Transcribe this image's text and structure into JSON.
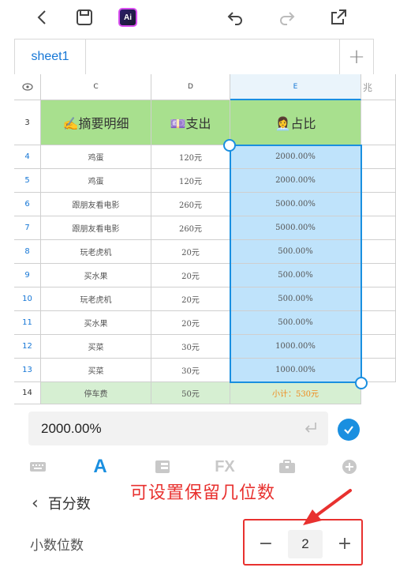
{
  "toolbar": {
    "back_icon": "chevron-left-icon",
    "save_icon": "save-icon",
    "ai_label": "Ai",
    "undo_icon": "undo-icon",
    "redo_icon": "redo-icon",
    "share_icon": "share-icon"
  },
  "tabs": {
    "sheet_name": "sheet1",
    "add_label": "+"
  },
  "grid": {
    "columns": [
      "C",
      "D",
      "E"
    ],
    "extra_column_fragment": "兆",
    "header_row": {
      "num": "3",
      "c": "✍摘要明细",
      "d": "💷支出",
      "e": "👩‍💼占比"
    },
    "rows": [
      {
        "num": "4",
        "c": "鸡蛋",
        "d": "120元",
        "e": "2000.00%"
      },
      {
        "num": "5",
        "c": "鸡蛋",
        "d": "120元",
        "e": "2000.00%"
      },
      {
        "num": "6",
        "c": "跟朋友看电影",
        "d": "260元",
        "e": "5000.00%"
      },
      {
        "num": "7",
        "c": "跟朋友看电影",
        "d": "260元",
        "e": "5000.00%"
      },
      {
        "num": "8",
        "c": "玩老虎机",
        "d": "20元",
        "e": "500.00%"
      },
      {
        "num": "9",
        "c": "买水果",
        "d": "20元",
        "e": "500.00%"
      },
      {
        "num": "10",
        "c": "玩老虎机",
        "d": "20元",
        "e": "500.00%"
      },
      {
        "num": "11",
        "c": "买水果",
        "d": "20元",
        "e": "500.00%"
      },
      {
        "num": "12",
        "c": "买菜",
        "d": "30元",
        "e": "1000.00%"
      },
      {
        "num": "13",
        "c": "买菜",
        "d": "30元",
        "e": "1000.00%"
      }
    ],
    "total_row": {
      "num": "14",
      "c": "停车费",
      "d": "50元",
      "e": "小计：530元"
    }
  },
  "formula_bar": {
    "value": "2000.00%"
  },
  "bottom_tabs": {
    "fx_label": "FX",
    "text_label": "A"
  },
  "panel": {
    "title": "百分数",
    "annotation": "可设置保留几位数",
    "decimals_label": "小数位数",
    "decimals_value": "2",
    "minus_label": "−",
    "plus_label": "+"
  },
  "colors": {
    "accent": "#1a8fe0",
    "header_green": "#a8e08e",
    "selection_fill": "#bfe3fb",
    "annotation_red": "#e8312f",
    "subtotal_orange": "#f08a1c"
  }
}
